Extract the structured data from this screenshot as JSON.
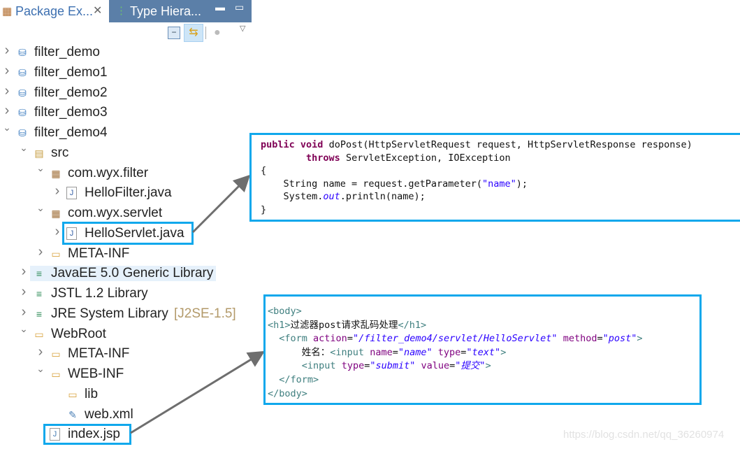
{
  "tabs": [
    {
      "label": "Package Ex...",
      "icon": "package-explorer-icon",
      "active": true
    },
    {
      "label": "Type Hiera...",
      "icon": "type-hierarchy-icon",
      "active": false
    }
  ],
  "toolbar": {
    "collapse_all": "collapse-all-icon",
    "link_editor": "link-with-editor-icon",
    "focus": "focus-task-icon",
    "view_menu": "view-menu-icon"
  },
  "tree": [
    {
      "label": "filter_demo",
      "level": 0,
      "arrow": "collapsed",
      "icon": "project"
    },
    {
      "label": "filter_demo1",
      "level": 0,
      "arrow": "collapsed",
      "icon": "project"
    },
    {
      "label": "filter_demo2",
      "level": 0,
      "arrow": "collapsed",
      "icon": "project"
    },
    {
      "label": "filter_demo3",
      "level": 0,
      "arrow": "collapsed",
      "icon": "project"
    },
    {
      "label": "filter_demo4",
      "level": 0,
      "arrow": "expanded",
      "icon": "project"
    },
    {
      "label": "src",
      "level": 1,
      "arrow": "expanded",
      "icon": "source-folder"
    },
    {
      "label": "com.wyx.filter",
      "level": 2,
      "arrow": "expanded",
      "icon": "package"
    },
    {
      "label": "HelloFilter.java",
      "level": 3,
      "arrow": "collapsed",
      "icon": "java-file"
    },
    {
      "label": "com.wyx.servlet",
      "level": 2,
      "arrow": "expanded",
      "icon": "package"
    },
    {
      "label": "HelloServlet.java",
      "level": 3,
      "arrow": "collapsed",
      "icon": "java-file"
    },
    {
      "label": "META-INF",
      "level": 2,
      "arrow": "collapsed",
      "icon": "folder"
    },
    {
      "label": "JavaEE 5.0 Generic Library",
      "level": 1,
      "arrow": "collapsed",
      "icon": "library",
      "selected": true
    },
    {
      "label": "JSTL 1.2 Library",
      "level": 1,
      "arrow": "collapsed",
      "icon": "library"
    },
    {
      "label": "JRE System Library",
      "decoration": "[J2SE-1.5]",
      "level": 1,
      "arrow": "collapsed",
      "icon": "library"
    },
    {
      "label": "WebRoot",
      "level": 1,
      "arrow": "expanded",
      "icon": "folder"
    },
    {
      "label": "META-INF",
      "level": 2,
      "arrow": "collapsed",
      "icon": "folder"
    },
    {
      "label": "WEB-INF",
      "level": 2,
      "arrow": "expanded",
      "icon": "folder"
    },
    {
      "label": "lib",
      "level": 3,
      "arrow": "none",
      "icon": "folder"
    },
    {
      "label": "web.xml",
      "level": 3,
      "arrow": "none",
      "icon": "xml-file"
    },
    {
      "label": "index.jsp",
      "level": 2,
      "arrow": "none",
      "icon": "jsp-file"
    }
  ],
  "code_java": {
    "l1a": "public",
    "l1b": " ",
    "l1c": "void",
    "l1d": " doPost(HttpServletRequest request, HttpServletResponse response)",
    "l2a": "        ",
    "l2b": "throws",
    "l2c": " ServletException, IOException",
    "l3": "{",
    "l4a": "    String name = request.getParameter(",
    "l4b": "\"name\"",
    "l4c": ");",
    "l5a": "    System.",
    "l5b": "out",
    "l5c": ".println(name);",
    "l6": "}"
  },
  "code_jsp": {
    "l1": "<body>",
    "l2a": "<h1>",
    "l2b": "过滤器post请求乱码处理",
    "l2c": "</h1>",
    "l3a": "  <form ",
    "l3b": "action",
    "l3c": "=",
    "l3d": "\"/filter_demo4/servlet/HelloServlet\"",
    "l3e": " ",
    "l3f": "method",
    "l3g": "=",
    "l3h": "\"post\"",
    "l3i": ">",
    "l4a": "      姓名：",
    "l4b": "<input ",
    "l4c": "name",
    "l4d": "=",
    "l4e": "\"name\"",
    "l4f": " ",
    "l4g": "type",
    "l4h": "=",
    "l4i": "\"text\"",
    "l4j": ">",
    "l5a": "      ",
    "l5b": "<input ",
    "l5c": "type",
    "l5d": "=",
    "l5e": "\"submit\"",
    "l5f": " ",
    "l5g": "value",
    "l5h": "=",
    "l5i": "\"提交\"",
    "l5j": ">",
    "l6": "  </form>",
    "l7": "</body>"
  },
  "watermark": "https://blog.csdn.net/qq_36260974",
  "colors": {
    "highlight": "#10a8ec",
    "tab_inactive": "#5b7fa8",
    "arrow": "#6e6e6e"
  }
}
